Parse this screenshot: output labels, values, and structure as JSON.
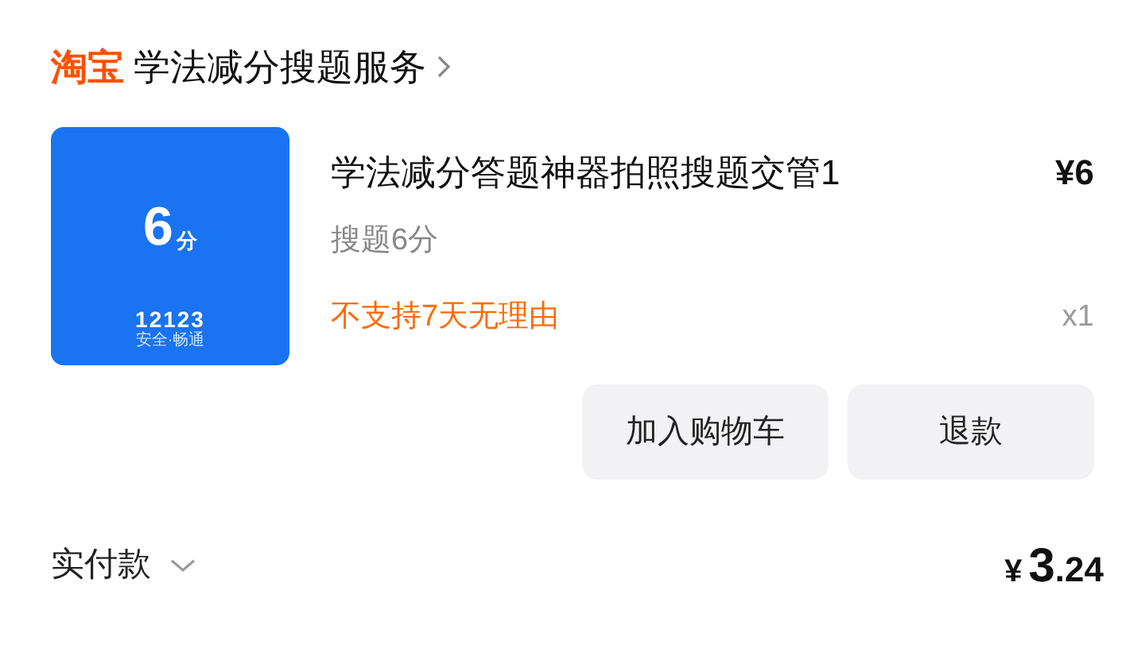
{
  "shop": {
    "platform": "淘宝",
    "name": "学法减分搜题服务"
  },
  "item": {
    "thumbnail": {
      "score": "6",
      "unit": "分",
      "code": "12123",
      "tagline": "安全·畅通"
    },
    "title": "学法减分答题神器拍照搜题交管1",
    "price": "¥6",
    "spec": "搜题6分",
    "policy": "不支持7天无理由",
    "quantity": "x1"
  },
  "buttons": [
    "加入购物车",
    "退款"
  ],
  "total": {
    "label": "实付款",
    "currency": "¥",
    "integer": "3",
    "decimal": ".24"
  }
}
